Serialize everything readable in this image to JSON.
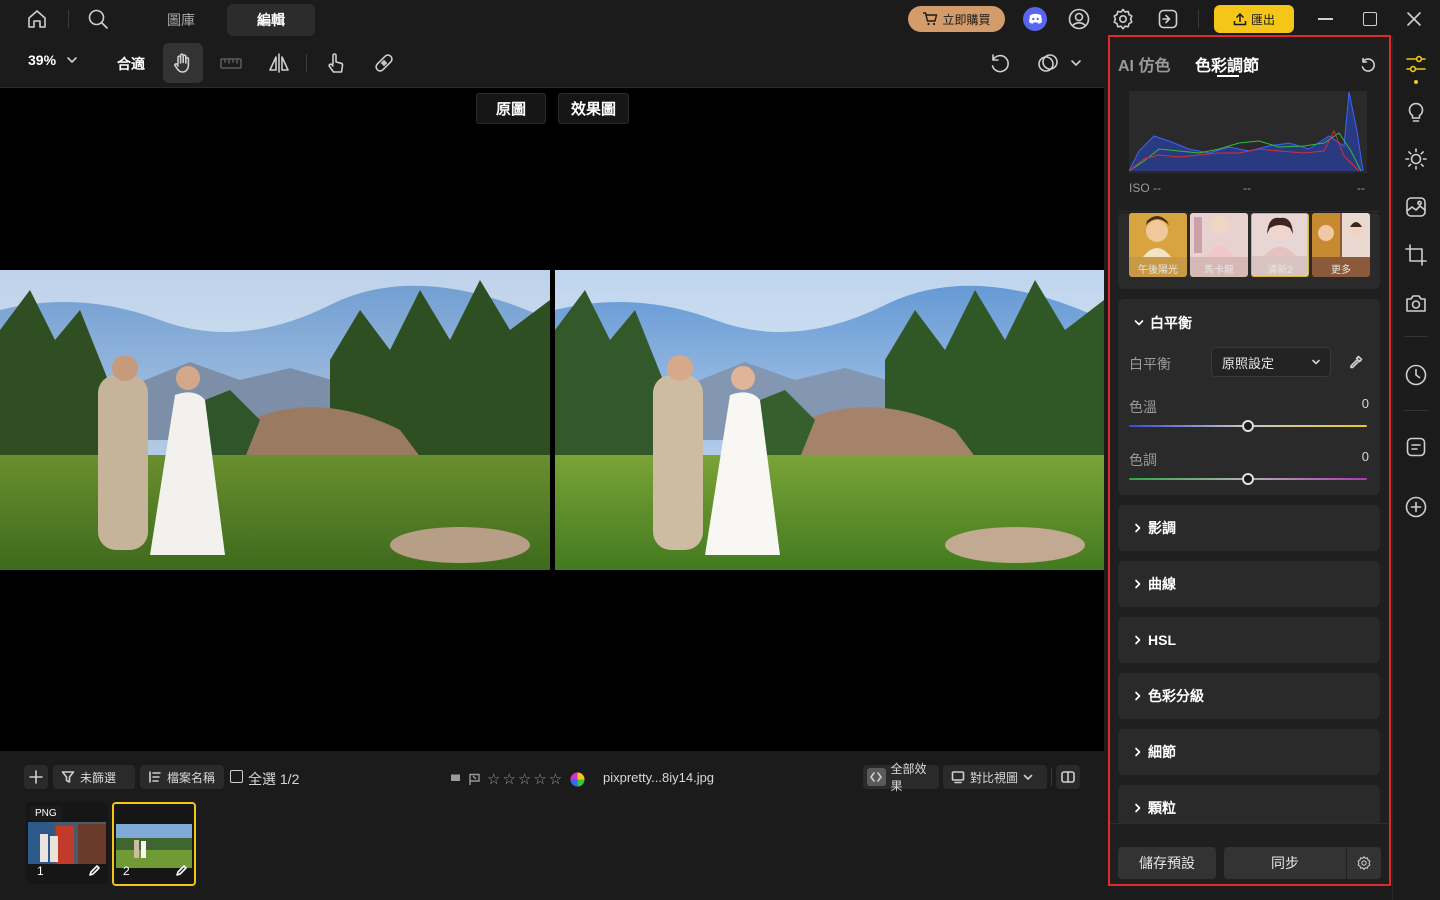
{
  "titlebar": {
    "tabs": [
      "圖庫",
      "編輯"
    ],
    "buy_label": "立即購買",
    "export_label": "匯出"
  },
  "toolbar": {
    "zoom": "39%",
    "fit_label": "合適"
  },
  "canvas": {
    "original_label": "原圖",
    "effect_label": "效果圖"
  },
  "filmstrip": {
    "filter_label": "未篩選",
    "sort_label": "檔案名稱",
    "select_all_label": "全選 1/2",
    "filename": "pixpretty...8iy14.jpg",
    "all_effects_label": "全部效果",
    "compare_view_label": "對比視圖",
    "thumbs": [
      {
        "badge": "PNG",
        "index": "1"
      },
      {
        "badge": "",
        "index": "2"
      }
    ]
  },
  "panel": {
    "tabs": [
      "AI 仿色",
      "色彩調節"
    ],
    "histogram": {
      "iso": "ISO --",
      "mid": "--",
      "right": "--"
    },
    "presets": [
      "午後陽光",
      "馬卡龍",
      "清新2",
      "更多"
    ],
    "white_balance": {
      "title": "白平衡",
      "wb_label": "白平衡",
      "wb_value": "原照設定",
      "temp_label": "色溫",
      "temp_value": "0",
      "tint_label": "色調",
      "tint_value": "0"
    },
    "sections": [
      "影調",
      "曲線",
      "HSL",
      "色彩分級",
      "細節",
      "顆粒"
    ],
    "save_preset_label": "儲存預設",
    "sync_label": "同步"
  },
  "colors": {
    "accent_yellow": "#f5c518",
    "buy_orange": "#d49c6a",
    "highlight_red": "#e1282e"
  }
}
